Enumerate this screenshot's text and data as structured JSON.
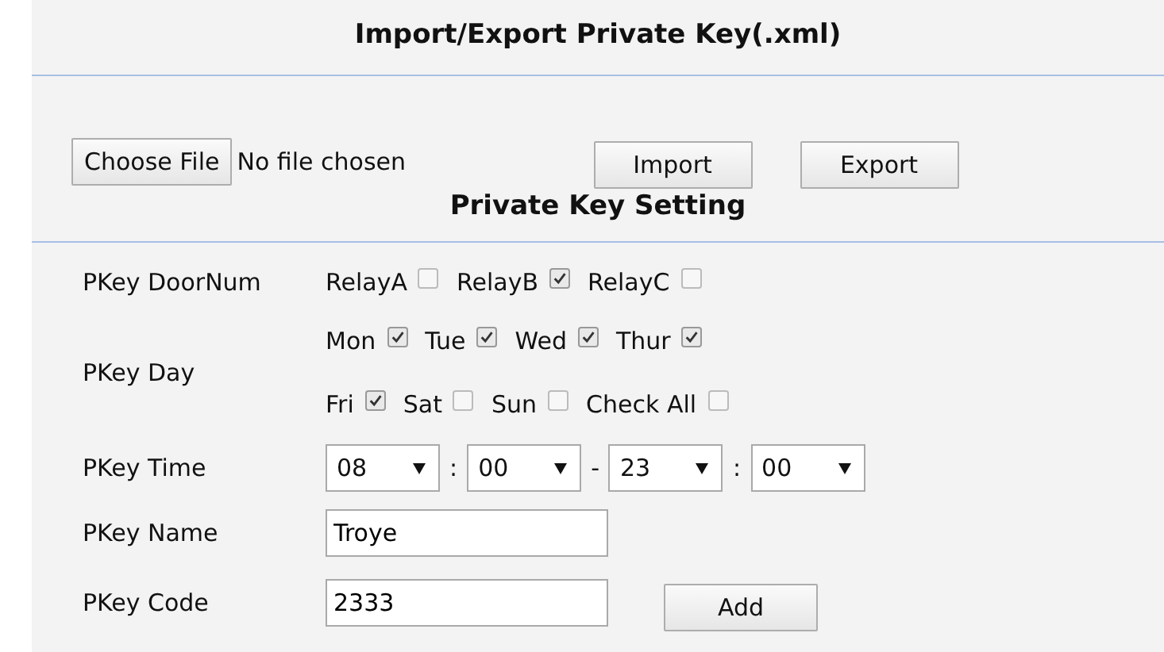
{
  "import_export": {
    "title": "Import/Export Private Key(.xml)",
    "file_button": "Choose File",
    "file_status": "No file chosen",
    "buttons": [
      "Import",
      "Export"
    ]
  },
  "settings": {
    "title": "Private Key Setting",
    "door": {
      "label": "PKey DoorNum",
      "options": [
        {
          "label": "RelayA",
          "checked": false
        },
        {
          "label": "RelayB",
          "checked": true
        },
        {
          "label": "RelayC",
          "checked": false
        }
      ]
    },
    "day": {
      "label": "PKey Day",
      "rows": [
        [
          {
            "label": "Mon",
            "checked": true
          },
          {
            "label": "Tue",
            "checked": true
          },
          {
            "label": "Wed",
            "checked": true
          },
          {
            "label": "Thur",
            "checked": true
          }
        ],
        [
          {
            "label": "Fri",
            "checked": true
          },
          {
            "label": "Sat",
            "checked": false
          },
          {
            "label": "Sun",
            "checked": false
          },
          {
            "label": "Check All",
            "checked": false
          }
        ]
      ]
    },
    "time": {
      "label": "PKey Time",
      "parts": [
        {
          "kind": "select",
          "value": "08"
        },
        {
          "kind": "sep",
          "text": ":"
        },
        {
          "kind": "select",
          "value": "00"
        },
        {
          "kind": "sep",
          "text": "-"
        },
        {
          "kind": "select",
          "value": "23"
        },
        {
          "kind": "sep",
          "text": ":"
        },
        {
          "kind": "select",
          "value": "00"
        }
      ]
    },
    "name": {
      "label": "PKey Name",
      "value": "Troye"
    },
    "code": {
      "label": "PKey Code",
      "value": "2333",
      "button": "Add"
    }
  }
}
